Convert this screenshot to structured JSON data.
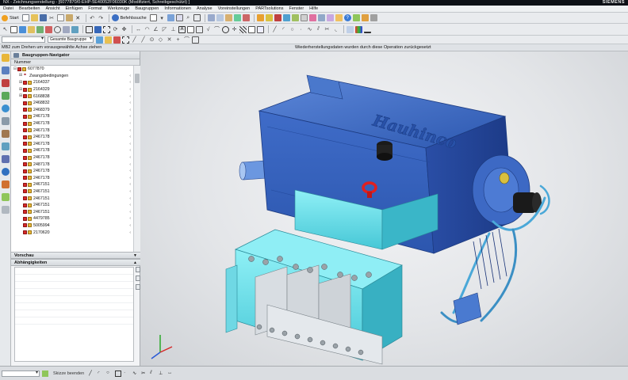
{
  "window": {
    "title": "NX - Zeichnungserstellung - [6077870/0-EHP-5E40052F06030K (Modifiziert, Schreibgeschützt) ]",
    "brand": "SIEMENS"
  },
  "menu": [
    "Datei",
    "Bearbeiten",
    "Ansicht",
    "Einfügen",
    "Format",
    "Werkzeuge",
    "Baugruppen",
    "Informationen",
    "Analyse",
    "Voreinstellungen",
    "PARTsolutions",
    "Fenster",
    "Hilfe"
  ],
  "toolbar": {
    "start_label": "Start",
    "command_finder_label": "Befehlssuche",
    "selection_filter": "",
    "assembly_scope": "Gesamte Baugruppe"
  },
  "cue_line": {
    "left": "MB2 zum Drehen um vorausgewählte Achse ziehen",
    "center": "Wiederherstellungsdaten wurden durch diese Operation zurückgesetzt"
  },
  "navigator": {
    "title": "Baugruppen-Navigator",
    "column_header": "Nummer",
    "rows": [
      {
        "label": "6077870",
        "kind": "root"
      },
      {
        "label": "Zwangsbedingungen",
        "kind": "constraints"
      },
      {
        "label": "2164337",
        "kind": "expandable"
      },
      {
        "label": "2164329",
        "kind": "expandable"
      },
      {
        "label": "6168838",
        "kind": "expandable"
      },
      {
        "label": "2468832",
        "kind": "part"
      },
      {
        "label": "2468379",
        "kind": "part"
      },
      {
        "label": "2467178",
        "kind": "part"
      },
      {
        "label": "2467178",
        "kind": "part"
      },
      {
        "label": "2467178",
        "kind": "part"
      },
      {
        "label": "2467178",
        "kind": "part"
      },
      {
        "label": "2467178",
        "kind": "part"
      },
      {
        "label": "2467178",
        "kind": "part"
      },
      {
        "label": "2467178",
        "kind": "part"
      },
      {
        "label": "2487178",
        "kind": "part"
      },
      {
        "label": "2467178",
        "kind": "part"
      },
      {
        "label": "2467178",
        "kind": "part"
      },
      {
        "label": "2467151",
        "kind": "part"
      },
      {
        "label": "2467151",
        "kind": "part"
      },
      {
        "label": "2467151",
        "kind": "part"
      },
      {
        "label": "2467151",
        "kind": "part"
      },
      {
        "label": "2467151",
        "kind": "part"
      },
      {
        "label": "4479785",
        "kind": "part"
      },
      {
        "label": "5005994",
        "kind": "part"
      },
      {
        "label": "2170620",
        "kind": "part"
      }
    ]
  },
  "preview": {
    "title": "Vorschau"
  },
  "dependencies": {
    "title": "Abhängigkeiten"
  },
  "model": {
    "logo_text": "Hauhinco"
  },
  "statusbar": {
    "finish_sketch": "Skizze beenden"
  },
  "colors": {
    "pump_blue": "#2f5fbf",
    "block_cyan": "#5ed8e4",
    "check_red": "#d62828",
    "part_yellow": "#e8b63a"
  }
}
